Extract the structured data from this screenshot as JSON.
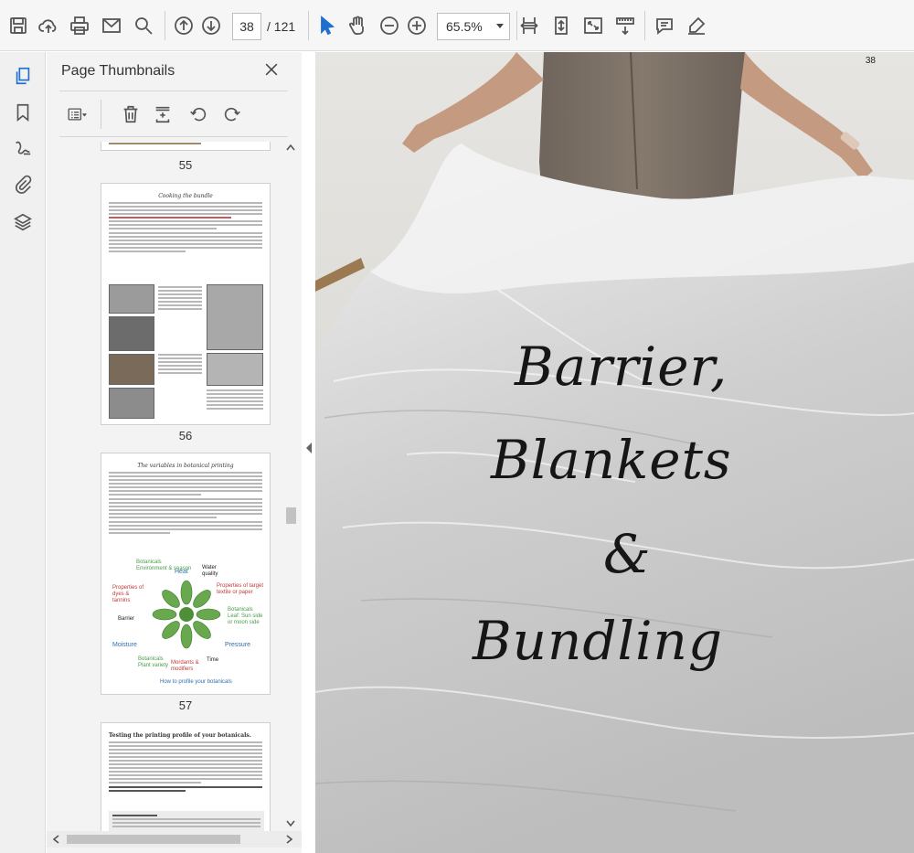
{
  "toolbar": {
    "current_page": "38",
    "total_pages": "/ 121",
    "zoom": "65.5%"
  },
  "panel": {
    "title": "Page Thumbnails"
  },
  "thumbnails": [
    {
      "label": "55"
    },
    {
      "label": "56",
      "heading": "Cooking the bundle"
    },
    {
      "label": "57",
      "heading": "The variables in botanical printing"
    },
    {
      "heading": "Testing the printing profile of your botanicals."
    }
  ],
  "wheel": {
    "botanicals_env": "Botanicals",
    "env": "Environment & season",
    "heat": "Heat",
    "water": "Water quality",
    "dyes": "Properties of dyes & tannins",
    "target": "Properties of target textile or paper",
    "barrier": "Barrier",
    "leaf": "Botanicals Leaf: Sun side or moon side",
    "moisture": "Moisture",
    "pressure": "Pressure",
    "time": "Time",
    "plant": "Botanicals Plant variety",
    "mordants": "Mordants & modifiers",
    "link": "How to profile your botanicals"
  },
  "document": {
    "page_number": "38",
    "title_lines": [
      "Barrier,",
      "Blankets",
      "&",
      "Bundling"
    ]
  }
}
